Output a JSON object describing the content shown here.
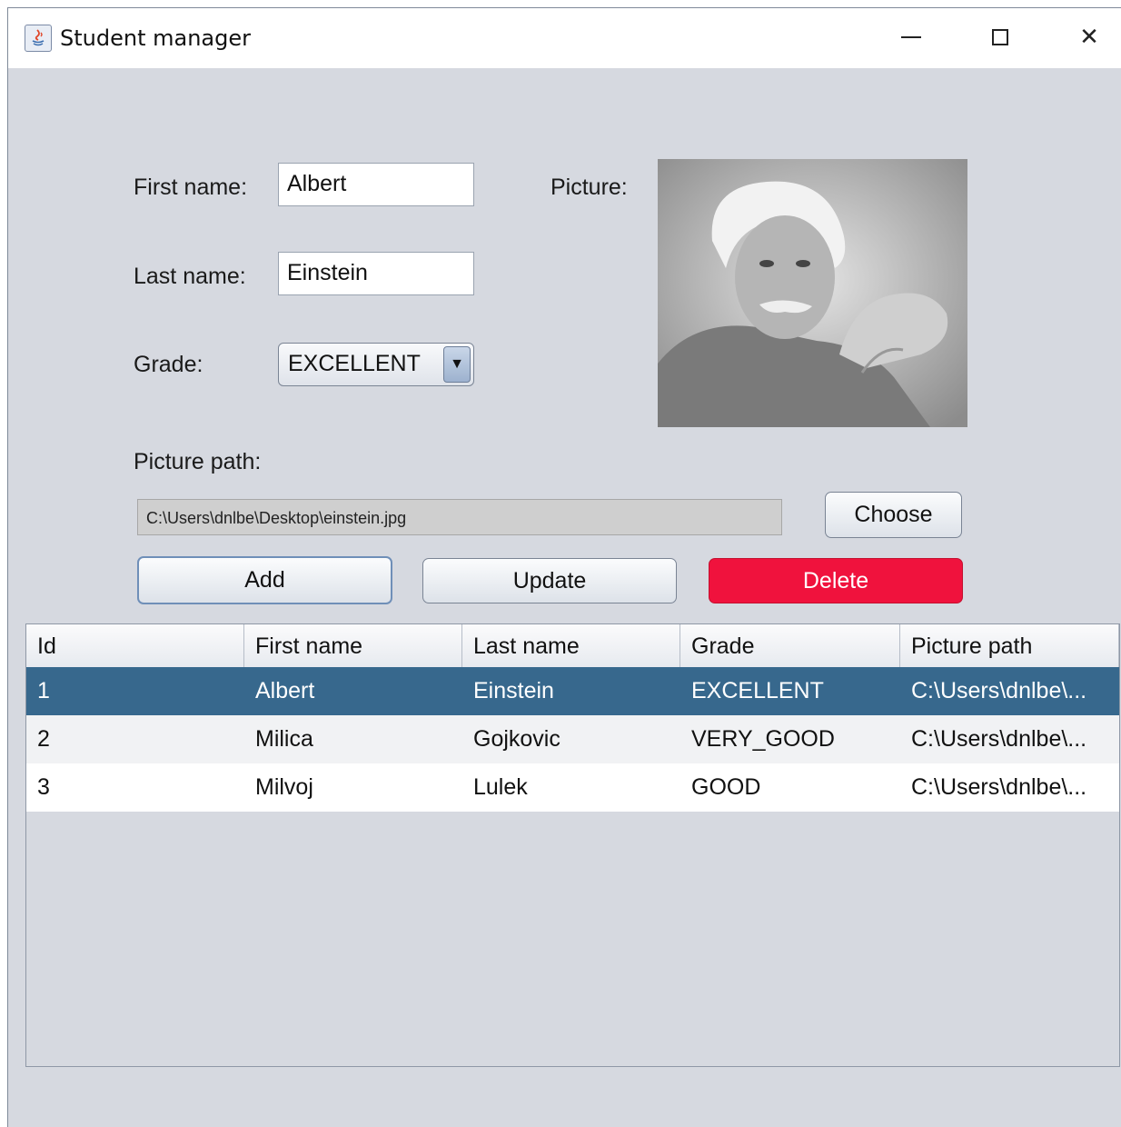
{
  "window": {
    "title": "Student manager",
    "minimize_glyph": "—",
    "maximize_glyph": "☐",
    "close_glyph": "✕"
  },
  "form": {
    "first_name_label": "First name:",
    "first_name_value": "Albert",
    "last_name_label": "Last name:",
    "last_name_value": "Einstein",
    "grade_label": "Grade:",
    "grade_value": "EXCELLENT",
    "grade_arrow": "▼",
    "picture_label": "Picture:",
    "picture_path_label": "Picture path:",
    "picture_path_value": "C:\\Users\\dnlbe\\Desktop\\einstein.jpg"
  },
  "buttons": {
    "choose": "Choose",
    "add": "Add",
    "update": "Update",
    "delete": "Delete"
  },
  "colors": {
    "delete_button": "#f0123d",
    "selected_row": "#37688d",
    "window_background": "#d6d9e0"
  },
  "table": {
    "columns": [
      "Id",
      "First name",
      "Last name",
      "Grade",
      "Picture path"
    ],
    "rows": [
      [
        "1",
        "Albert",
        "Einstein",
        "EXCELLENT",
        "C:\\Users\\dnlbe\\..."
      ],
      [
        "2",
        "Milica",
        "Gojkovic",
        "VERY_GOOD",
        "C:\\Users\\dnlbe\\..."
      ],
      [
        "3",
        "Milvoj",
        "Lulek",
        "GOOD",
        "C:\\Users\\dnlbe\\..."
      ]
    ],
    "selected_row": 0
  }
}
